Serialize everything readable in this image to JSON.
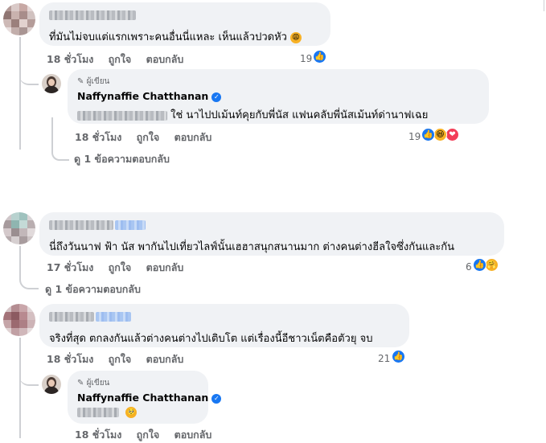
{
  "comments": [
    {
      "text": "ที่มันไม่จบแต่แรกเพราะคนอื่นนี่แหละ เห็นแล้วปวดหัว",
      "time": "18 ชั่วโมง",
      "like": "ถูกใจ",
      "reply": "ตอบกลับ",
      "reaction_count": "19",
      "emoji": "weary-face"
    },
    {
      "author_badge": "ผู้เขียน",
      "name": "Naffynaffie Chatthanan",
      "text": "ใช่ นาไปปเม้นท์คุยกับพี่นัส แฟนคลับพี่นัสเม้นท์ด่านาฟเฉย",
      "time": "18 ชั่วโมง",
      "like": "ถูกใจ",
      "reply": "ตอบกลับ",
      "reaction_count": "19",
      "reactions": [
        "like",
        "haha",
        "love"
      ],
      "view_replies": "ดู 1 ข้อความตอบกลับ"
    },
    {
      "text": "นี่ถึงวันนาฟ ฟ้า นัส พากันไปเที่ยวไลฟ์นั้นเฮฮาสนุกสนานมาก ต่างคนต่างฮีลใจซึ่งกันและกัน",
      "time": "17 ชั่วโมง",
      "like": "ถูกใจ",
      "reply": "ตอบกลับ",
      "reaction_count": "6",
      "reactions": [
        "like",
        "care"
      ],
      "view_replies": "ดู 1 ข้อความตอบกลับ"
    },
    {
      "text": "จริงที่สุด ตกลงกันแล้วต่างคนต่างไปเติบโต แต่เรื่องนี้อีชาวเน็ตคือตัวยุ จบ",
      "time": "18 ชั่วโมง",
      "like": "ถูกใจ",
      "reply": "ตอบกลับ",
      "reaction_count": "21",
      "reactions": [
        "like"
      ]
    },
    {
      "author_badge": "ผู้เขียน",
      "name": "Naffynaffie Chatthanan",
      "emoji": "pleading-face",
      "time": "18 ชั่วโมง",
      "like": "ถูกใจ",
      "reply": "ตอบกลับ"
    }
  ],
  "colors": {
    "bubble": "#f0f2f5",
    "meta_text": "#65676b",
    "like_blue": "#1877f2",
    "love_red": "#f33e58",
    "emoji_yellow": "#f7b125"
  }
}
